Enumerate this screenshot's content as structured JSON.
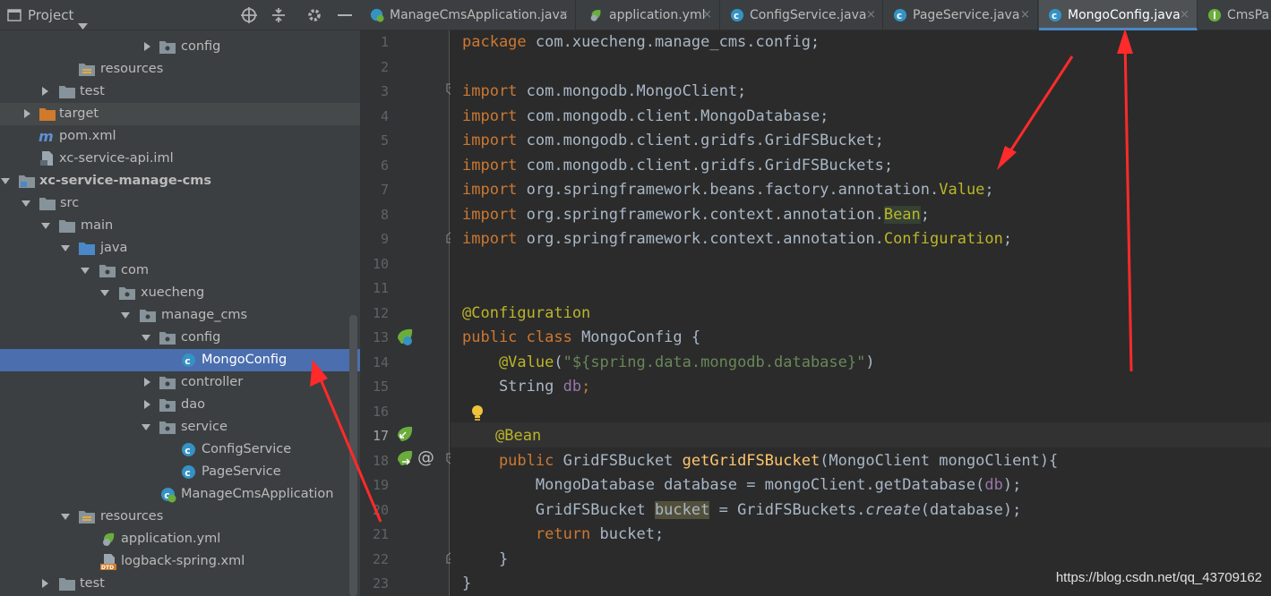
{
  "project_panel": {
    "title": "Project",
    "dropdown_icon": "triangle-down-icon",
    "header_icons": [
      "locate-icon",
      "collapse-all-icon",
      "settings-icon",
      "minimize-icon"
    ]
  },
  "tree": [
    {
      "label": "config",
      "depth": "collapsed-folder"
    },
    {
      "label": "resources"
    },
    {
      "label": "test"
    },
    {
      "label": "target"
    },
    {
      "label": "pom.xml"
    },
    {
      "label": "xc-service-api.iml"
    },
    {
      "label": "xc-service-manage-cms"
    },
    {
      "label": "src"
    },
    {
      "label": "main"
    },
    {
      "label": "java"
    },
    {
      "label": "com"
    },
    {
      "label": "xuecheng"
    },
    {
      "label": "manage_cms"
    },
    {
      "label": "config"
    },
    {
      "label": "MongoConfig"
    },
    {
      "label": "controller"
    },
    {
      "label": "dao"
    },
    {
      "label": "service"
    },
    {
      "label": "ConfigService"
    },
    {
      "label": "PageService"
    },
    {
      "label": "ManageCmsApplication"
    },
    {
      "label": "resources"
    },
    {
      "label": "application.yml"
    },
    {
      "label": "logback-spring.xml"
    },
    {
      "label": "test"
    }
  ],
  "tabs": [
    {
      "label": "ManageCmsApplication.java"
    },
    {
      "label": "application.yml"
    },
    {
      "label": "ConfigService.java"
    },
    {
      "label": "PageService.java"
    },
    {
      "label": "MongoConfig.java"
    },
    {
      "label": "CmsPa"
    }
  ],
  "tab_close": "×",
  "line_numbers": [
    "1",
    "2",
    "3",
    "4",
    "5",
    "6",
    "7",
    "8",
    "9",
    "10",
    "11",
    "12",
    "13",
    "14",
    "15",
    "16",
    "17",
    "18",
    "19",
    "20",
    "21",
    "22",
    "23"
  ],
  "code": {
    "l1_kw": "package",
    "l1_rest": " com.xuecheng.manage_cms.config;",
    "import_kw": "import",
    "l3": " com.mongodb.MongoClient;",
    "l4": " com.mongodb.client.MongoDatabase;",
    "l5": " com.mongodb.client.gridfs.GridFSBucket;",
    "l6": " com.mongodb.client.gridfs.GridFSBuckets;",
    "l7_a": " org.springframework.beans.factory.annotation.",
    "l7_b": "Value",
    "l7_c": ";",
    "l8_a": " org.springframework.context.annotation.",
    "l8_b": "Bean",
    "l8_c": ";",
    "l9_a": " org.springframework.context.annotation.",
    "l9_b": "Configuration",
    "l9_c": ";",
    "l12": "@Configuration",
    "l13_kw": "public class",
    "l13_rest": " MongoConfig {",
    "l14_ann": "    @Value",
    "l14_p": "(",
    "l14_str": "\"${spring.data.mongodb.database}\"",
    "l14_e": ")",
    "l15_a": "    String ",
    "l15_f": "db",
    "l15_c": ";",
    "l17": "@Bean",
    "l18_kw": "    public",
    "l18_a": " GridFSBucket ",
    "l18_fn": "getGridFSBucket",
    "l18_b": "(MongoClient mongoClient){",
    "l19_a": "        MongoDatabase database = mongoClient.getDatabase(",
    "l19_f": "db",
    "l19_b": ");",
    "l20_a": "        GridFSBucket ",
    "l20_hl": "bucket",
    "l20_b": " = GridFSBuckets.",
    "l20_it": "create",
    "l20_c": "(database);",
    "l21_kw": "        return",
    "l21_rest": " bucket;",
    "l22": "    }",
    "l23": "}"
  },
  "watermark": "https://blog.csdn.net/qq_43709162",
  "colors": {
    "selection": "#4b6eaf",
    "keyword": "#cc7832",
    "annotation": "#bbb529",
    "string": "#6a8759",
    "arrow": "#ff2a2a"
  }
}
